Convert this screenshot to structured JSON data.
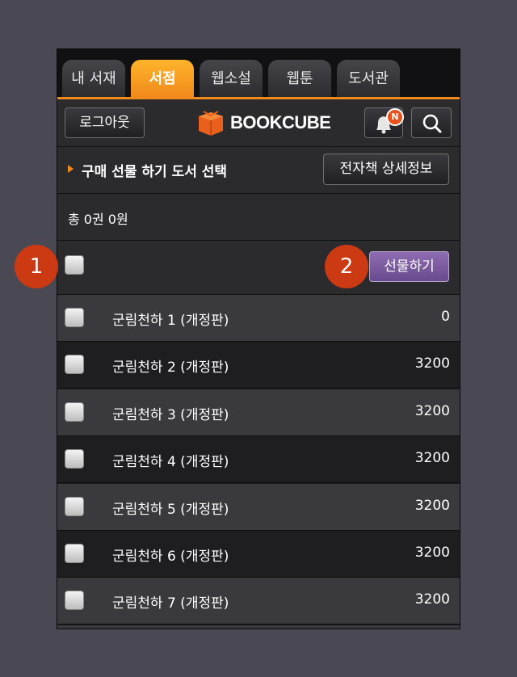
{
  "tabs": [
    {
      "label": "내 서재",
      "active": false
    },
    {
      "label": "서점",
      "active": true
    },
    {
      "label": "웹소설",
      "active": false
    },
    {
      "label": "웹툰",
      "active": false
    },
    {
      "label": "도서관",
      "active": false
    }
  ],
  "header": {
    "logout_label": "로그아웃",
    "logo_text": "BOOKCUBE",
    "notification_badge": "N",
    "icons": [
      "bell-icon",
      "search-icon"
    ]
  },
  "section": {
    "title": "구매 선물 하기 도서 선택",
    "detail_button": "전자책 상세정보"
  },
  "summary": {
    "text": "총 0권 0원"
  },
  "actions": {
    "gift_button": "선물하기"
  },
  "books": [
    {
      "title": "군림천하 1 (개정판)",
      "price": "0"
    },
    {
      "title": "군림천하 2 (개정판)",
      "price": "3200"
    },
    {
      "title": "군림천하 3 (개정판)",
      "price": "3200"
    },
    {
      "title": "군림천하 4 (개정판)",
      "price": "3200"
    },
    {
      "title": "군림천하 5 (개정판)",
      "price": "3200"
    },
    {
      "title": "군림천하 6 (개정판)",
      "price": "3200"
    },
    {
      "title": "군림천하 7 (개정판)",
      "price": "3200"
    }
  ],
  "annotations": [
    {
      "label": "1"
    },
    {
      "label": "2"
    }
  ],
  "colors": {
    "accent": "#f08a1c",
    "gift": "#7a5a9e",
    "badge": "#cc3a14"
  }
}
